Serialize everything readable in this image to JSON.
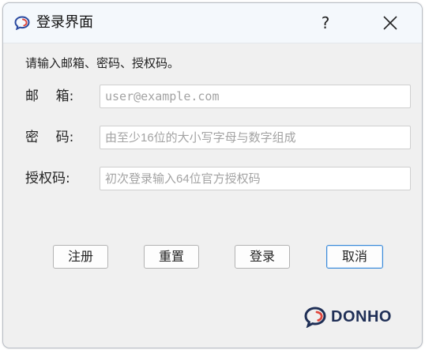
{
  "window": {
    "title": "登录界面",
    "help_label": "?",
    "app_icon": "chat-bubble-icon",
    "close_icon": "close-icon"
  },
  "form": {
    "instruction": "请输入邮箱、密码、授权码。",
    "fields": [
      {
        "label": "邮    箱:",
        "value": "",
        "placeholder": "user@example.com"
      },
      {
        "label": "密    码:",
        "value": "",
        "placeholder": "由至少16位的大小写字母与数字组成"
      },
      {
        "label": "授权码:",
        "value": "",
        "placeholder": "初次登录输入64位官方授权码"
      }
    ]
  },
  "buttons": {
    "register": "注册",
    "reset": "重置",
    "login": "登录",
    "cancel": "取消"
  },
  "brand": {
    "name": "DONHO",
    "icon": "donho-logo-icon"
  },
  "colors": {
    "accent": "#3b8ad9",
    "brand_text": "#1f2f56",
    "brand_red": "#e0473d"
  }
}
